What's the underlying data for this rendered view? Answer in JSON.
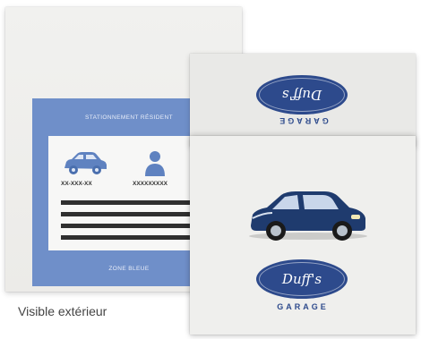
{
  "permit": {
    "header": "STATIONNEMENT RÉSIDENT",
    "plate": "XX-XXX-XX",
    "resident": "XXXXXXXXX",
    "footer": "ZONE BLEUE",
    "caption": "Visible extérieur",
    "icons": [
      "car-icon",
      "person-icon"
    ]
  },
  "garage": {
    "logo_text": "Duff's",
    "name": "GARAGE"
  },
  "colors": {
    "permit_blue": "#6f8fc9",
    "garage_blue": "#2d4a8c",
    "car_blue": "#1f3b6e"
  }
}
